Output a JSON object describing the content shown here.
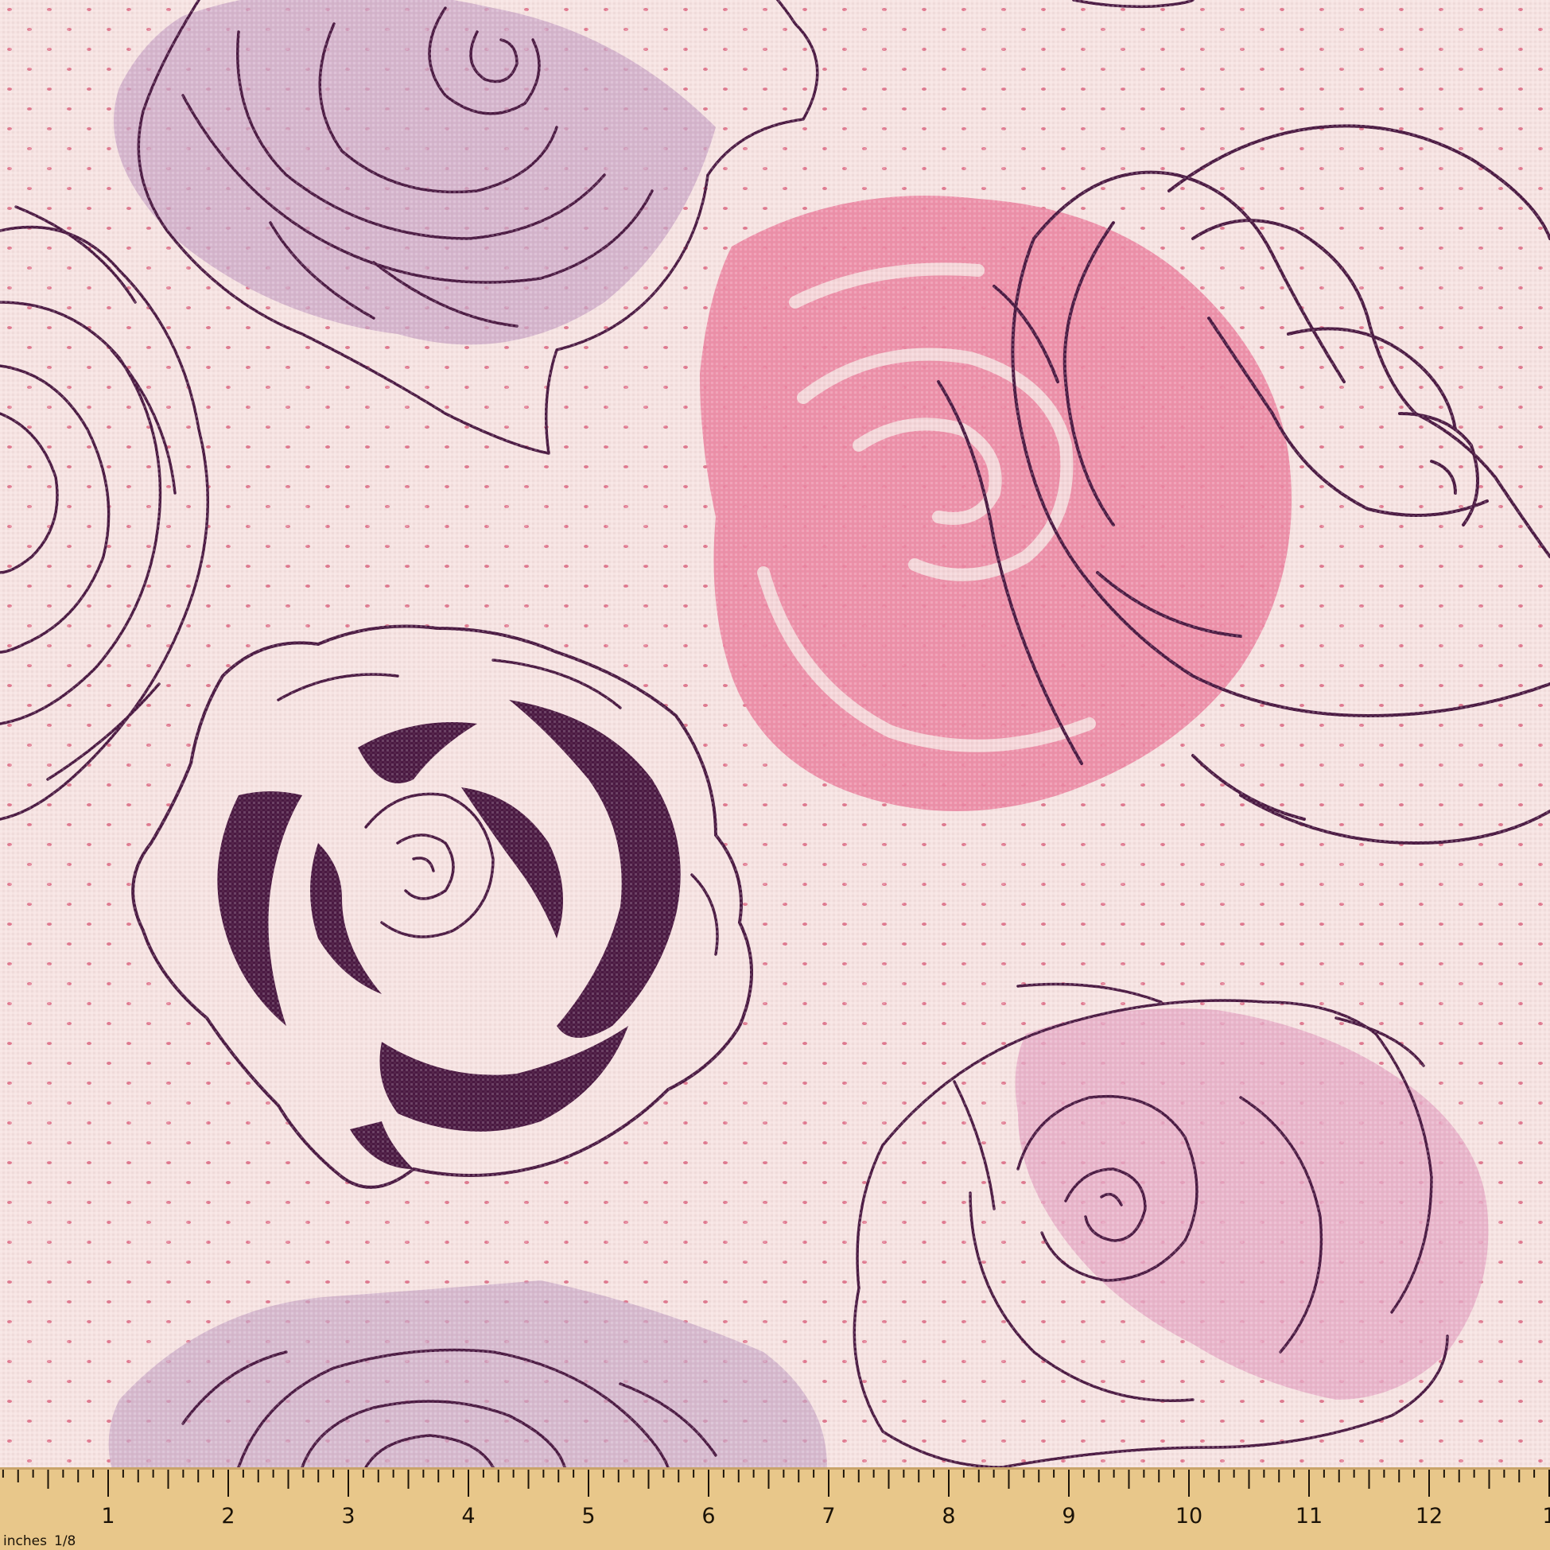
{
  "colors": {
    "fabric_base": "#f6e3e2",
    "dot": "#e0788f",
    "outline": "#4a1942",
    "dark_fill": "#4a1942",
    "lilac_wash": "#c9a6c6",
    "pink_wash": "#ec86a3",
    "soft_pink_wash": "#e6a9c6",
    "ruler_wood": "#e8c78a",
    "ruler_ink": "#1b1308"
  },
  "ruler": {
    "unit_label": "inches",
    "fraction_label": "1/8",
    "numbers": [
      "1",
      "2",
      "3",
      "4",
      "5",
      "6",
      "7",
      "8",
      "9",
      "10",
      "11",
      "12",
      "1"
    ]
  }
}
